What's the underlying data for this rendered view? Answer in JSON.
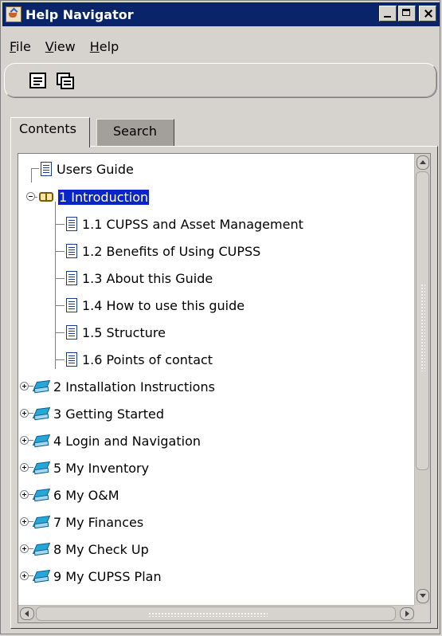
{
  "window": {
    "title": "Help Navigator",
    "minimize": "_",
    "maximize": "□",
    "close": "×"
  },
  "menubar": [
    {
      "label": "File",
      "mnemonic": "F",
      "rest": "ile"
    },
    {
      "label": "View",
      "mnemonic": "V",
      "rest": "iew"
    },
    {
      "label": "Help",
      "mnemonic": "H",
      "rest": "elp"
    }
  ],
  "toolbar": {
    "buttons": [
      "document-icon",
      "multi-document-icon"
    ]
  },
  "tabs": [
    {
      "label": "Contents",
      "active": true
    },
    {
      "label": "Search",
      "active": false
    }
  ],
  "tree": {
    "root": "Users Guide",
    "items": [
      {
        "label": "1 Introduction",
        "expanded": true,
        "selected": true,
        "children": [
          "1.1 CUPSS and Asset Management",
          "1.2 Benefits of Using CUPSS",
          "1.3 About this Guide",
          "1.4 How to use this guide",
          "1.5 Structure",
          "1.6 Points of contact"
        ]
      },
      {
        "label": "2 Installation Instructions",
        "expanded": false
      },
      {
        "label": "3 Getting Started",
        "expanded": false
      },
      {
        "label": "4 Login and Navigation",
        "expanded": false
      },
      {
        "label": "5 My Inventory",
        "expanded": false
      },
      {
        "label": "6 My O&M",
        "expanded": false
      },
      {
        "label": "7 My Finances",
        "expanded": false
      },
      {
        "label": "8 My Check Up",
        "expanded": false
      },
      {
        "label": "9 My CUPSS Plan",
        "expanded": false
      }
    ]
  },
  "colors": {
    "title_bar": "#0a246a",
    "selection": "#0a24c8",
    "face": "#d6d3ce"
  }
}
